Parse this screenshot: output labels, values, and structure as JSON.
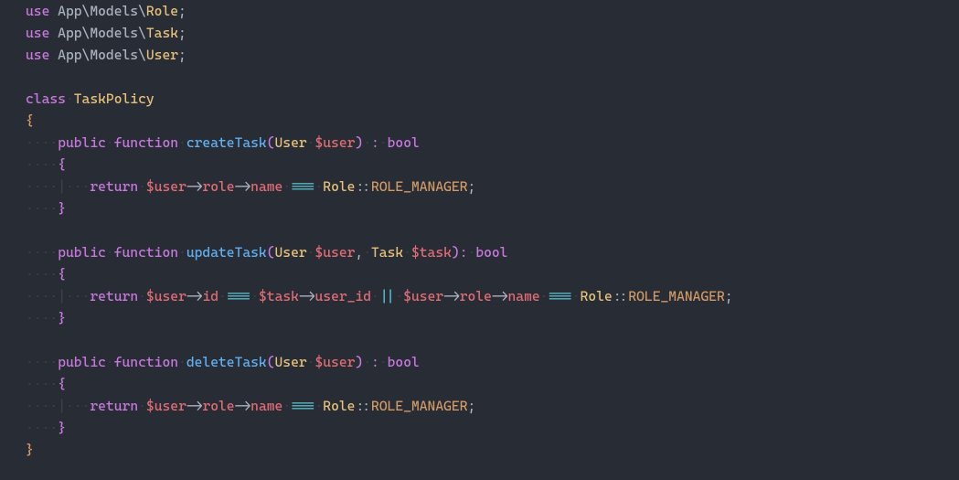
{
  "dot": "·",
  "pipe": "|",
  "lines": {
    "l1": {
      "kw1": "use",
      "sp": " ",
      "ns": "App\\Models\\",
      "cls": "Role",
      "semi": ";"
    },
    "l2": {
      "kw1": "use",
      "sp": " ",
      "ns": "App\\Models\\",
      "cls": "Task",
      "semi": ";"
    },
    "l3": {
      "kw1": "use",
      "sp": " ",
      "ns": "App\\Models\\",
      "cls": "User",
      "semi": ";"
    },
    "l5": {
      "kw1": "class",
      "sp": " ",
      "cls": "TaskPolicy"
    },
    "l6": {
      "br": "{"
    },
    "l7": {
      "kw1": "public",
      "kw2": "function",
      "name": "createTask",
      "lp": "(",
      "typ": "User",
      "var": "$user",
      "rp": ")",
      "colon": ":",
      "ret": "bool"
    },
    "l8": {
      "br": "{"
    },
    "l9": {
      "kw": "return",
      "var": "$user",
      "arr1": "->",
      "p1": "role",
      "arr2": "->",
      "p2": "name",
      "eq": "===",
      "cls": "Role",
      "dd": "::",
      "const": "ROLE_MANAGER",
      "semi": ";"
    },
    "l10": {
      "br": "}"
    },
    "l12": {
      "kw1": "public",
      "kw2": "function",
      "name": "updateTask",
      "lp": "(",
      "typ1": "User",
      "var1": "$user",
      "comma": ",",
      "typ2": "Task",
      "var2": "$task",
      "rp": ")",
      "colon": ":",
      "ret": "bool"
    },
    "l13": {
      "br": "{"
    },
    "l14": {
      "kw": "return",
      "var1": "$user",
      "arr1": "->",
      "p1": "id",
      "eq1": "===",
      "var2": "$task",
      "arr2": "->",
      "p2": "user_id",
      "or": "||",
      "var3": "$user",
      "arr3": "->",
      "p3": "role",
      "arr4": "->",
      "p4": "name",
      "eq2": "===",
      "cls": "Role",
      "dd": "::",
      "const": "ROLE_MANAGER",
      "semi": ";"
    },
    "l15": {
      "br": "}"
    },
    "l17": {
      "kw1": "public",
      "kw2": "function",
      "name": "deleteTask",
      "lp": "(",
      "typ": "User",
      "var": "$user",
      "rp": ")",
      "colon": ":",
      "ret": "bool"
    },
    "l18": {
      "br": "{"
    },
    "l19": {
      "kw": "return",
      "var": "$user",
      "arr1": "->",
      "p1": "role",
      "arr2": "->",
      "p2": "name",
      "eq": "===",
      "cls": "Role",
      "dd": "::",
      "const": "ROLE_MANAGER",
      "semi": ";"
    },
    "l20": {
      "br": "}"
    },
    "l21": {
      "br": "}"
    }
  }
}
